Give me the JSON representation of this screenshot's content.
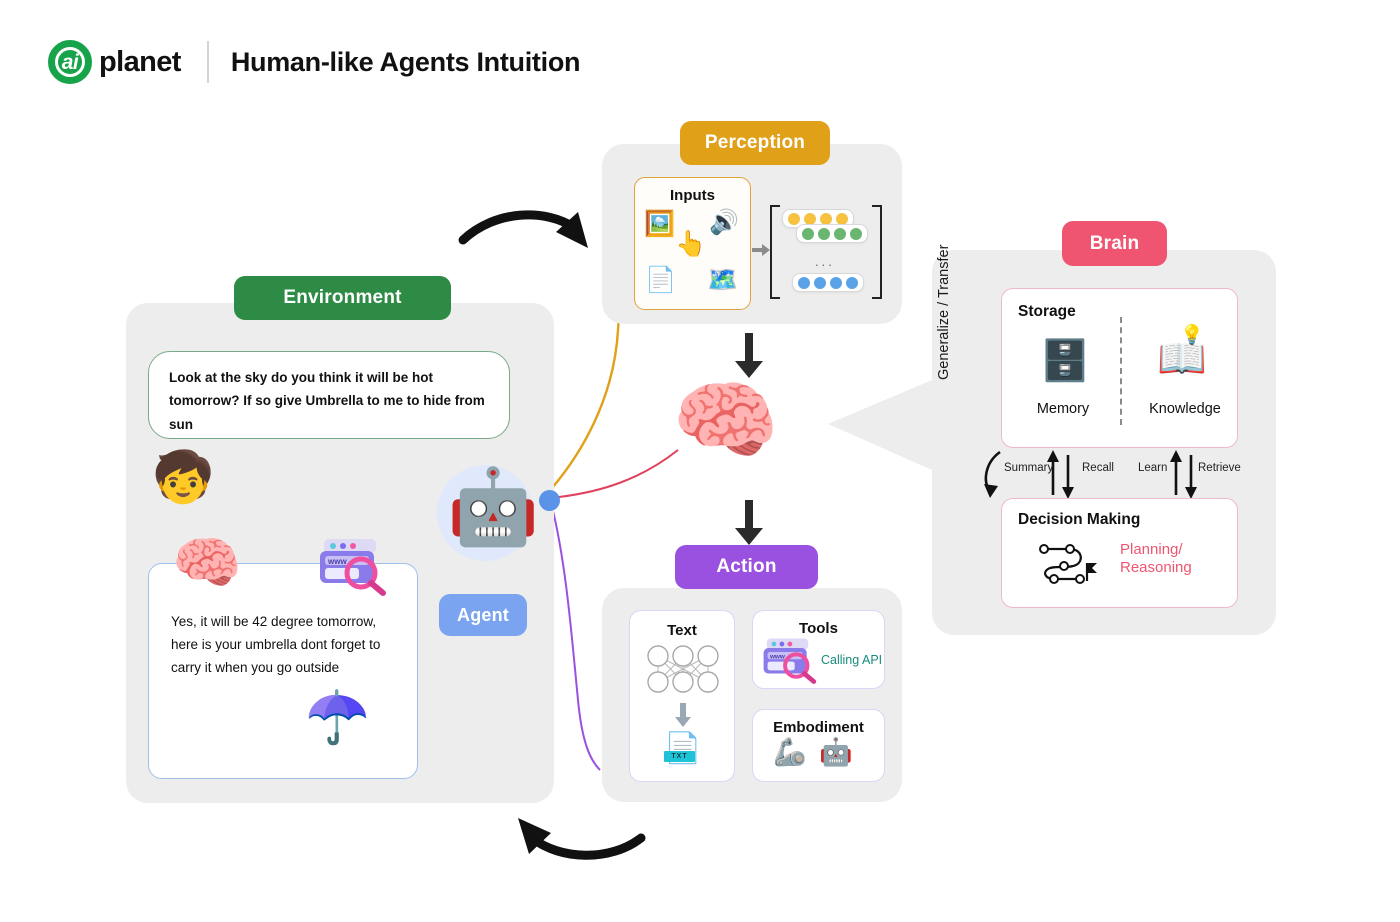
{
  "header": {
    "logo_ai": "ai",
    "logo_word": "planet",
    "title": "Human-like Agents Intuition"
  },
  "environment": {
    "pill_label": "Environment",
    "user_message": "Look at the sky do you think it will be hot tomorrow? If so give Umbrella to me to hide from sun",
    "agent_message": "Yes, it will be 42 degree tomorrow, here is your umbrella dont forget to carry it when you go outside",
    "user_icon": "boy-emoji",
    "brain_icon": "brain-emoji",
    "browser_search_icon": "browser-search-icon",
    "umbrella_icon": "umbrella-emoji"
  },
  "agent": {
    "label": "Agent",
    "avatar_icon": "robot-avatar-icon",
    "connector_dot": "agent-connector-dot"
  },
  "perception": {
    "pill_label": "Perception",
    "inputs_title": "Inputs",
    "input_icons": [
      "image-icon",
      "speaker-icon",
      "touch-hand-icon",
      "document-icon",
      "map-pin-icon"
    ],
    "matrix": {
      "rows": [
        {
          "color": "#f5c242",
          "count": 4
        },
        {
          "color": "#6ab56f",
          "count": 4
        },
        {
          "color": "#5ba3e8",
          "count": 4
        }
      ],
      "ellipsis": "..."
    }
  },
  "action": {
    "pill_label": "Action",
    "text_card": {
      "title": "Text",
      "network_icon": "neural-network-icon",
      "file_icon": "txt-file-icon"
    },
    "tools_card": {
      "title": "Tools",
      "api_label": "Calling API",
      "icon": "browser-search-icon"
    },
    "embodiment_card": {
      "title": "Embodiment",
      "icons": [
        "robot-hand-icon",
        "robot-body-icon"
      ]
    }
  },
  "brain": {
    "pill_label": "Brain",
    "generalize_label": "Generalize / Transfer",
    "storage": {
      "title": "Storage",
      "memory_label": "Memory",
      "memory_icon": "database-icon",
      "knowledge_label": "Knowledge",
      "knowledge_icon": "open-book-bulb-icon"
    },
    "decision": {
      "title": "Decision Making",
      "planning_label_line1": "Planning/",
      "planning_label_line2": "Reasoning",
      "icon": "path-flag-icon"
    },
    "links": {
      "summary": "Summary",
      "recall": "Recall",
      "learn": "Learn",
      "retrieve": "Retrieve"
    }
  },
  "center": {
    "brain_icon": "pink-brain-icon"
  },
  "colors": {
    "environment": "#2e8b45",
    "perception": "#e0a018",
    "action": "#9b51e0",
    "brain": "#ef5571",
    "agent": "#7ba4f0",
    "panel_bg": "#ededed",
    "calling_api": "#168c7d",
    "planning": "#ef5571"
  }
}
